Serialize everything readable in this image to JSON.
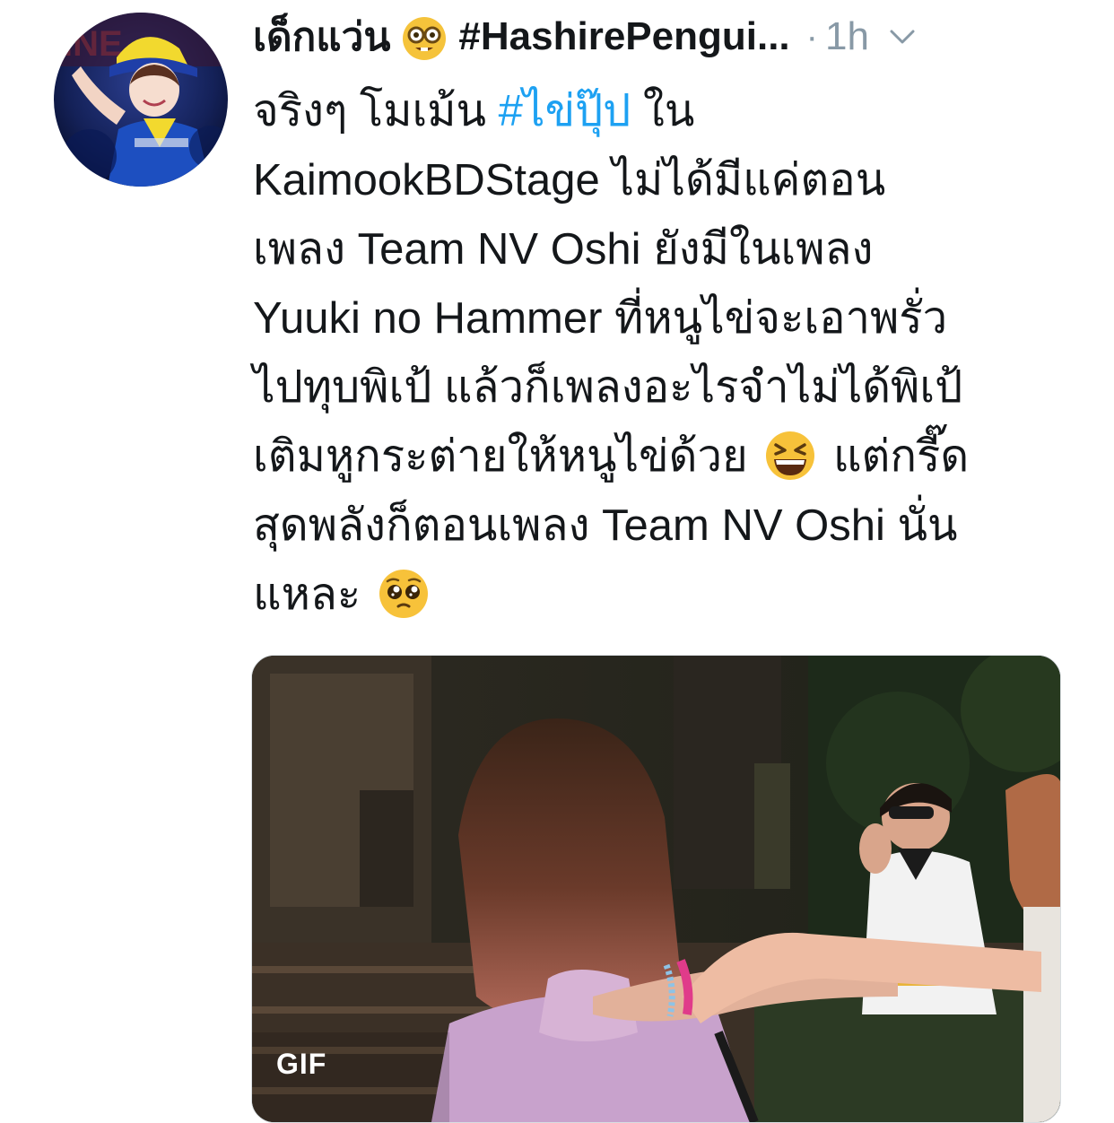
{
  "tweet": {
    "display_name": "เด็กแว่น",
    "name_emoji": "nerd-face-emoji",
    "name_hashtag": "#HashirePengui...",
    "separator": "·",
    "time": "1h",
    "menu_icon": "chevron-down-icon",
    "body_lines": [
      {
        "pre": "จริงๆ โมเม้น ",
        "hashtag": "#ไข่ปุ๊ป",
        "post": " ใน"
      },
      {
        "text": "KaimookBDStage ไม่ได้มีแค่ตอน"
      },
      {
        "text": "เพลง Team NV Oshi ยังมีในเพลง"
      },
      {
        "text": "Yuuki no Hammer ที่หนูไข่จะเอาพรั่ว"
      },
      {
        "text": "ไปทุบพิเป้ แล้วก็เพลงอะไรจำไม่ได้พิเป้"
      },
      {
        "pre": "เติมหูกระต่ายให้หนูไข่ด้วย ",
        "emoji": "grinning-squinting-face-emoji",
        "post": " แต่กรี๊ด"
      },
      {
        "text": "สุดพลังก็ตอนเพลง Team NV Oshi นั่น"
      },
      {
        "pre": "แหละ ",
        "emoji": "pleading-face-emoji",
        "post": ""
      }
    ],
    "media": {
      "type_badge": "GIF"
    }
  },
  "colors": {
    "link": "#1da1f2",
    "meta": "#8899a6",
    "text": "#14171a"
  }
}
